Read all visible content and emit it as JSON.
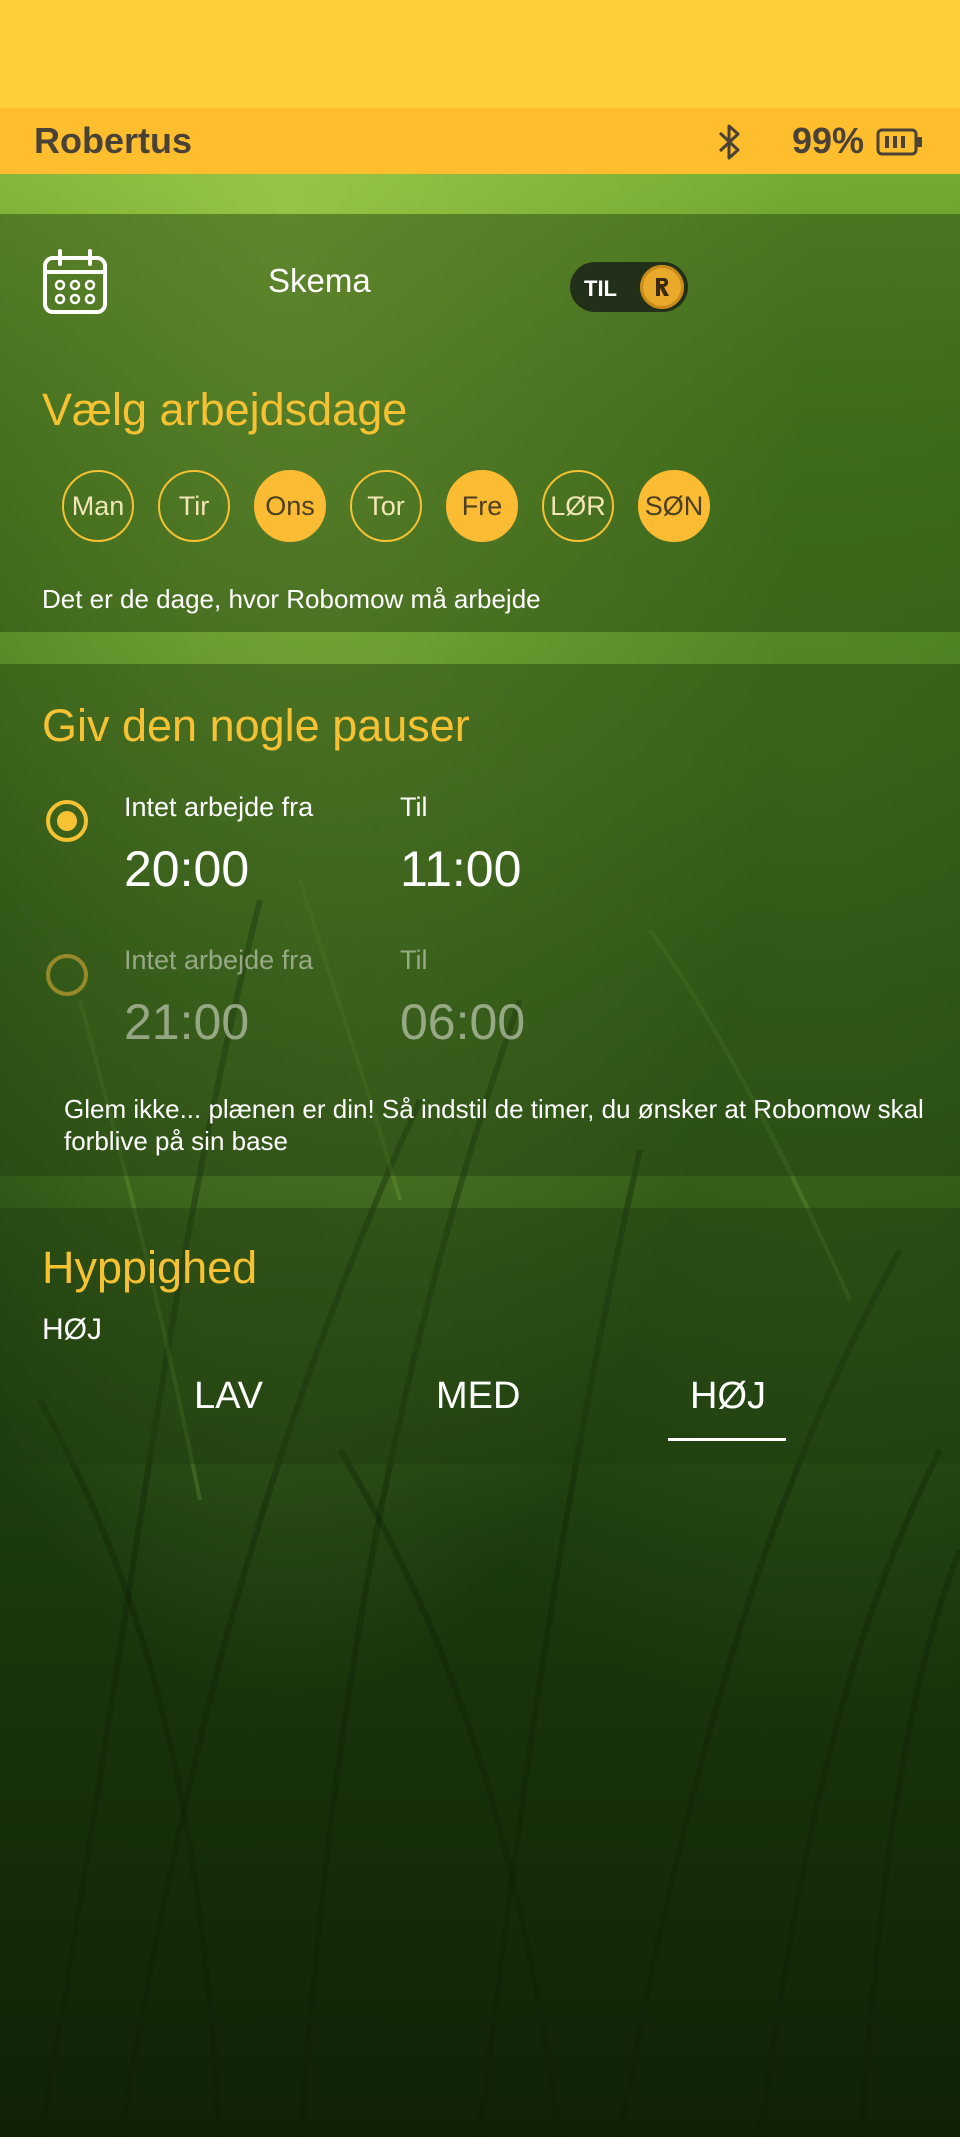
{
  "app": {
    "title": "Robertus"
  },
  "status": {
    "battery_percent": "99%",
    "bluetooth_icon": "bluetooth-icon",
    "battery_icon": "battery-icon"
  },
  "schedule": {
    "label": "Skema",
    "toggle_label": "TIL",
    "toggle_on": true
  },
  "workdays": {
    "title": "Vælg arbejdsdage",
    "days": [
      {
        "label": "Man",
        "selected": false
      },
      {
        "label": "Tir",
        "selected": false
      },
      {
        "label": "Ons",
        "selected": true
      },
      {
        "label": "Tor",
        "selected": false
      },
      {
        "label": "Fre",
        "selected": true
      },
      {
        "label": "LØR",
        "selected": false
      },
      {
        "label": "SØN",
        "selected": true
      }
    ],
    "hint": "Det er de dage, hvor Robomow må arbejde"
  },
  "breaks": {
    "title": "Giv den nogle pauser",
    "items": [
      {
        "from_label": "Intet arbejde fra",
        "from": "20:00",
        "to_label": "Til",
        "to": "11:00",
        "selected": true
      },
      {
        "from_label": "Intet arbejde fra",
        "from": "21:00",
        "to_label": "Til",
        "to": "06:00",
        "selected": false
      }
    ],
    "hint": "Glem ikke... plænen er din! Så indstil de timer, du ønsker at Robomow skal forblive på sin base"
  },
  "frequency": {
    "title": "Hyppighed",
    "current": "HØJ",
    "options": [
      "LAV",
      "MED",
      "HØJ"
    ],
    "selected_index": 2
  },
  "colors": {
    "accent": "#f6c132",
    "header": "#ffbe2e",
    "statusbar": "#ffcf3a"
  }
}
